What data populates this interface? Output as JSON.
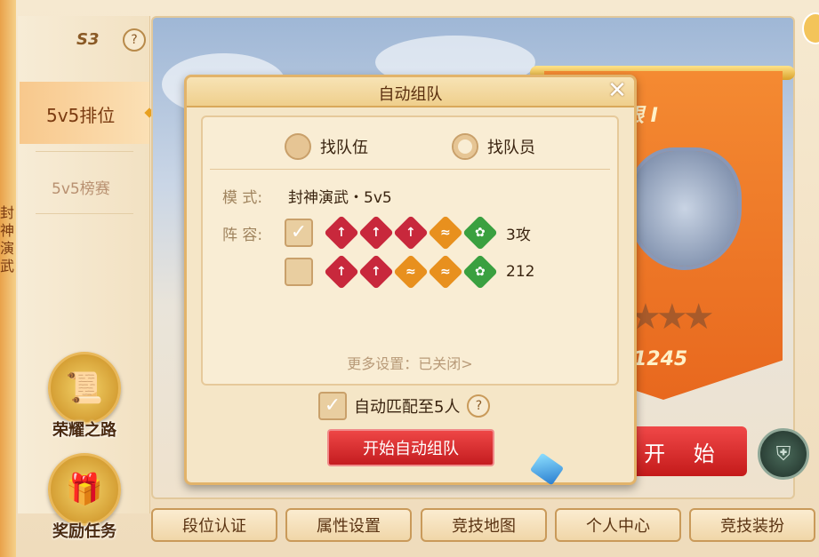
{
  "season": {
    "label": "S3",
    "help": "?"
  },
  "left_edge_text": "封神演武",
  "nav": [
    {
      "label": "5v5排位",
      "active": true
    },
    {
      "label": "5v5榜赛",
      "active": false
    }
  ],
  "side_buttons": [
    {
      "label": "荣耀之路",
      "icon": "scroll-icon"
    },
    {
      "label": "奖励任务",
      "icon": "treasure-chest-icon"
    }
  ],
  "rank_banner": {
    "title": "白银 I",
    "score": "1245",
    "stars_total": 3
  },
  "start_button": "开 始",
  "bottom_buttons": [
    "段位认证",
    "属性设置",
    "竞技地图",
    "个人中心",
    "竞技装扮"
  ],
  "dialog": {
    "title": "自动组队",
    "close": "✕",
    "radios": [
      {
        "label": "找队伍",
        "selected": false
      },
      {
        "label": "找队员",
        "selected": true
      }
    ],
    "mode_key": "模 式:",
    "mode_value": "封神演武・5v5",
    "lineup_key": "阵 容:",
    "lineups": [
      {
        "checked": true,
        "roles": [
          "attack",
          "attack",
          "attack",
          "support",
          "heal"
        ],
        "text": "3攻"
      },
      {
        "checked": false,
        "roles": [
          "attack",
          "attack",
          "support",
          "support",
          "heal"
        ],
        "text": "212"
      }
    ],
    "more_settings": "更多设置：已关闭>",
    "auto_match": {
      "checked": true,
      "label": "自动匹配至5人",
      "help": "?"
    },
    "begin_button": "开始自动组队"
  },
  "colors": {
    "attack": "#c8283c",
    "support": "#e8901e",
    "heal": "#3aa040",
    "accent": "#d42a2a"
  }
}
